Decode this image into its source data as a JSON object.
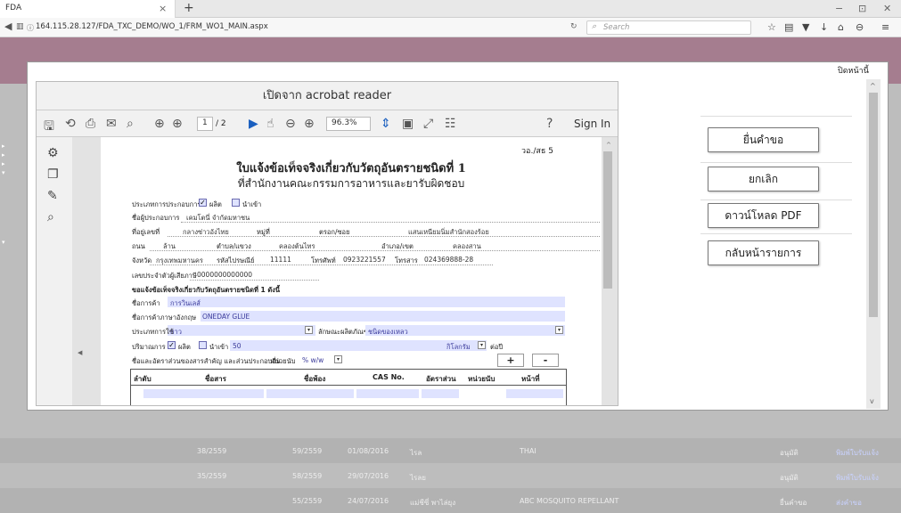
{
  "browser": {
    "tab_title": "FDA",
    "tab_close": "×",
    "new_tab": "+",
    "url": "164.115.28.127/FDA_TXC_DEMO/WO_1/FRM_WO1_MAIN.aspx",
    "search_placeholder": "Search",
    "window_controls": [
      "−",
      "⊡",
      "✕"
    ]
  },
  "modal": {
    "close_label": "ปิดหน้านี้"
  },
  "pdf_viewer": {
    "header": "เปิดจาก acrobat reader",
    "page_current": "1",
    "page_total": "/ 2",
    "zoom": "96.3%",
    "sign_in": "Sign In"
  },
  "document": {
    "doc_no": "วอ./สธ 5",
    "title_line1": "ใบแจ้งข้อเท็จจริงเกี่ยวกับวัตถุอันตรายชนิดที่ 1",
    "title_line2": "ที่สำนักงานคณะกรรมการอาหารและยารับผิดชอบ",
    "business_type_label": "ประเภทการประกอบการ",
    "produce_label": "ผลิต",
    "import_label": "นำเข้า",
    "operator_label": "ชื่อผู้ประกอบการ",
    "operator_value": "เคมโตนี่ จำกัดมหาชน",
    "address_label": "ที่อยู่เลขที่",
    "address_value": "กลางซ่าวอังไทย",
    "moo_label": "หมู่ที่",
    "soi_label": "ตรอก/ซอย",
    "soi_value": "แสนเหนียมนิ่มสำนักสองร้อย",
    "road_label": "ถนน",
    "road_value": "ล้าน",
    "subdistrict_label": "ตำบล/แขวง",
    "subdistrict_value": "คลองต้นไทร",
    "district_label": "อำเภอ/เขต",
    "district_value": "คลองสาน",
    "province_label": "จังหวัด",
    "province_value": "กรุงเทพมหานคร",
    "postcode_label": "รหัสไปรษณีย์",
    "postcode_value": "11111",
    "phone_label": "โทรศัพท์",
    "phone_value": "0923221557",
    "fax_label": "โทรสาร",
    "fax_value": "024369888-28",
    "taxid_label": "เลขประจำตัวผู้เสียภาษี",
    "taxid_value": "0000000000000",
    "section_title": "ขอแจ้งข้อเท็จจริงเกี่ยวกับวัตถุอันตรายชนิดที่ 1 ดังนี้",
    "trade_name_label": "ชื่อการค้า",
    "trade_name_value": "การวินเลส์",
    "trade_name_en_label": "ชื่อการค้าภาษาอังกฤษ",
    "trade_name_en_value": "ONEDAY GLUE",
    "usage_type_label": "ประเภทการใช้",
    "usage_type_value": "กาว",
    "product_nature_label": "ลักษณะผลิตภัณฑ์",
    "product_nature_value": "ชนิดของเหลว",
    "quantity_label": "ปริมาณการ",
    "qty_produce_label": "ผลิต",
    "qty_import_label": "นำเข้า",
    "qty_value": "50",
    "unit_value": "กิโลกรัม",
    "per_year_label": "ต่อปี",
    "composition_label": "ชื่อและอัตราส่วนของสารสำคัญ และส่วนประกอบอื่น",
    "composition_unit_label": "หน่วยนับ",
    "composition_unit_value": "% w/w",
    "add_btn": "+",
    "remove_btn": "-",
    "table_headers": [
      "ลำดับ",
      "ชื่อสาร",
      "ชื่อพ้อง",
      "CAS No.",
      "อัตราส่วน",
      "หน่วยนับ",
      "หน้าที่"
    ]
  },
  "actions": {
    "submit": "ยื่นคำขอ",
    "cancel": "ยกเลิก",
    "download": "ดาวน์โหลด PDF",
    "back": "กลับหน้ารายการ"
  },
  "background_rows": [
    {
      "col1": "38/2559",
      "col2": "59/2559",
      "date": "01/08/2016",
      "name": "ไรล",
      "product": "THAI",
      "status": "อนุมัติ",
      "link": "พิมพ์ใบรับแจ้ง"
    },
    {
      "col1": "35/2559",
      "col2": "58/2559",
      "date": "29/07/2016",
      "name": "ไรลย",
      "product": "",
      "status": "อนุมัติ",
      "link": "พิมพ์ใบรับแจ้ง"
    },
    {
      "col1": "",
      "col2": "55/2559",
      "date": "24/07/2016",
      "name": "แม่ชีซี่ พาไล่ยุง",
      "product": "ABC MOSQUITO REPELLANT",
      "status": "ยื่นคำขอ",
      "link": "ส่งคำขอ"
    }
  ]
}
